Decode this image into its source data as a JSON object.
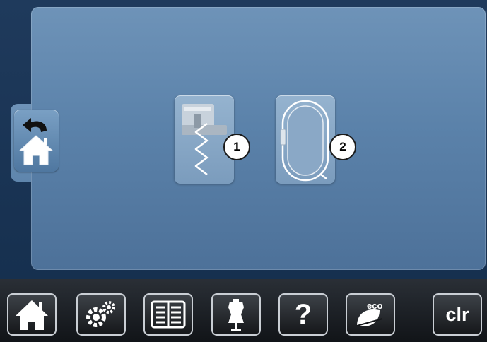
{
  "screen": {
    "back_button": {
      "icon": "back-home-icon"
    },
    "modes": [
      {
        "icon": "presser-foot-sewing-icon",
        "badge": "1"
      },
      {
        "icon": "embroidery-hoop-icon",
        "badge": "2"
      }
    ]
  },
  "toolbar": {
    "home": {
      "icon": "home-icon"
    },
    "setup": {
      "icon": "gears-icon"
    },
    "tutorial": {
      "icon": "book-icon"
    },
    "creative_consultant": {
      "icon": "dress-form-icon"
    },
    "help": {
      "icon": "question-icon",
      "label": "?"
    },
    "eco": {
      "icon": "eco-leaf-icon",
      "label": "eco"
    },
    "clear": {
      "label": "clr"
    }
  },
  "colors": {
    "panel_top": "#6e93b8",
    "panel_bottom": "#4d7199",
    "screen_bg": "#1f3a5c",
    "toolbar_bg": "#1a1d21",
    "button_border": "#c9ced4"
  }
}
